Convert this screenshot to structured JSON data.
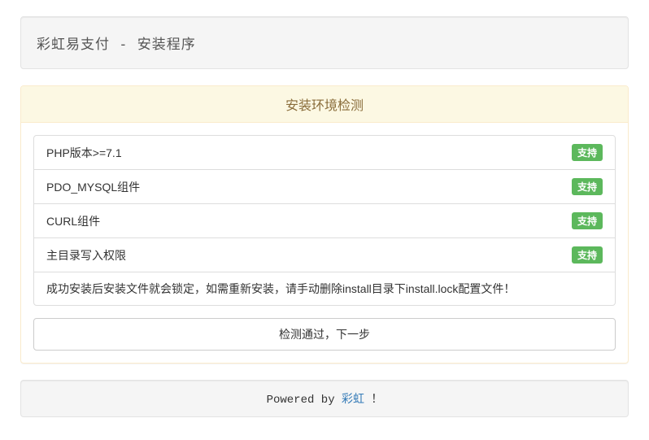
{
  "header": {
    "title": "彩虹易支付 - 安装程序"
  },
  "panel": {
    "title": "安装环境检测",
    "checks": [
      {
        "label": "PHP版本>=7.1",
        "status": "支持"
      },
      {
        "label": "PDO_MYSQL组件",
        "status": "支持"
      },
      {
        "label": "CURL组件",
        "status": "支持"
      },
      {
        "label": "主目录写入权限",
        "status": "支持"
      }
    ],
    "note": "成功安装后安装文件就会锁定，如需重新安装，请手动删除install目录下install.lock配置文件！",
    "next_button": "检测通过，下一步"
  },
  "footer": {
    "powered_prefix": "Powered by ",
    "powered_link": "彩虹",
    "powered_suffix": " ！"
  }
}
